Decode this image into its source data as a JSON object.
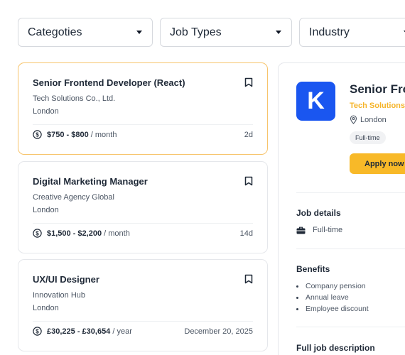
{
  "filters": [
    {
      "label": "Categoties"
    },
    {
      "label": "Job Types"
    },
    {
      "label": "Industry"
    }
  ],
  "jobs": [
    {
      "title": "Senior Frontend Developer (React)",
      "company": "Tech Solutions Co., Ltd.",
      "location": "London",
      "salary_range": "$750 - $800",
      "salary_period": " / month",
      "posted": "2d"
    },
    {
      "title": "Digital Marketing Manager",
      "company": "Creative Agency Global",
      "location": "London",
      "salary_range": "$1,500 - $2,200",
      "salary_period": " / month",
      "posted": "14d"
    },
    {
      "title": "UX/UI Designer",
      "company": "Innovation Hub",
      "location": "London",
      "salary_range": "£30,225 - £30,654",
      "salary_period": " / year",
      "posted": "December 20, 2025"
    }
  ],
  "detail": {
    "logo_letter": "K",
    "title": "Senior Frontend Developer (React)",
    "company": "Tech Solutions Co., Ltd.",
    "location": "London",
    "tag": "Full-time",
    "apply_label": "Apply now",
    "job_details_heading": "Job details",
    "job_type": "Full-time",
    "benefits_heading": "Benefits",
    "benefits": [
      "Company pension",
      "Annual leave",
      "Employee discount"
    ],
    "full_description_heading": "Full job description"
  },
  "colors": {
    "accent": "#f8b928",
    "logo_bg": "#1a56f0",
    "active_border": "#f7c46c"
  }
}
